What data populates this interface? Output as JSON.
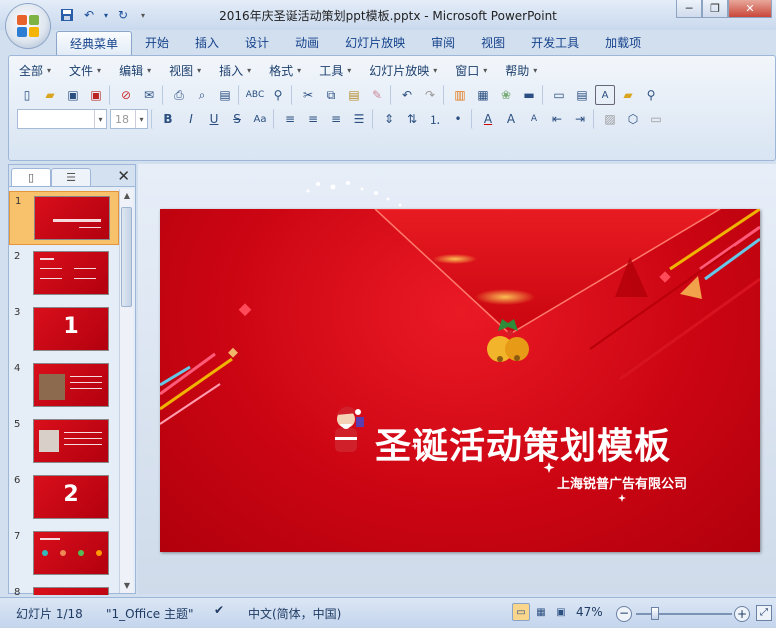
{
  "window": {
    "title": "2016年庆圣诞活动策划ppt模板.pptx - Microsoft PowerPoint",
    "controls": [
      "minimize",
      "restore",
      "close"
    ]
  },
  "quick_access": [
    "save-icon",
    "undo-icon",
    "redo-icon",
    "customize-icon"
  ],
  "tabs": [
    "经典菜单",
    "开始",
    "插入",
    "设计",
    "动画",
    "幻灯片放映",
    "审阅",
    "视图",
    "开发工具",
    "加载项"
  ],
  "active_tab": "经典菜单",
  "menus": [
    "全部",
    "文件",
    "编辑",
    "视图",
    "插入",
    "格式",
    "工具",
    "幻灯片放映",
    "窗口",
    "帮助"
  ],
  "font": {
    "family_value": "",
    "size_value": "18"
  },
  "slides_pane": {
    "numbers": [
      "1",
      "2",
      "3",
      "4",
      "5",
      "6",
      "7",
      "8"
    ],
    "selected": 1,
    "thumb_big_text": {
      "3": "1",
      "6": "2"
    }
  },
  "slide": {
    "title": "圣诞活动策划模板",
    "subtitle": "上海锐普广告有限公司"
  },
  "statusbar": {
    "slide_index": "幻灯片 1/18",
    "theme": "\"1_Office 主题\"",
    "language": "中文(简体，中国)",
    "zoom": "47%"
  },
  "colors": {
    "slide_red": "#cc0513",
    "accent_gold": "#f0b400",
    "selected_thumb": "#f7c26b"
  }
}
